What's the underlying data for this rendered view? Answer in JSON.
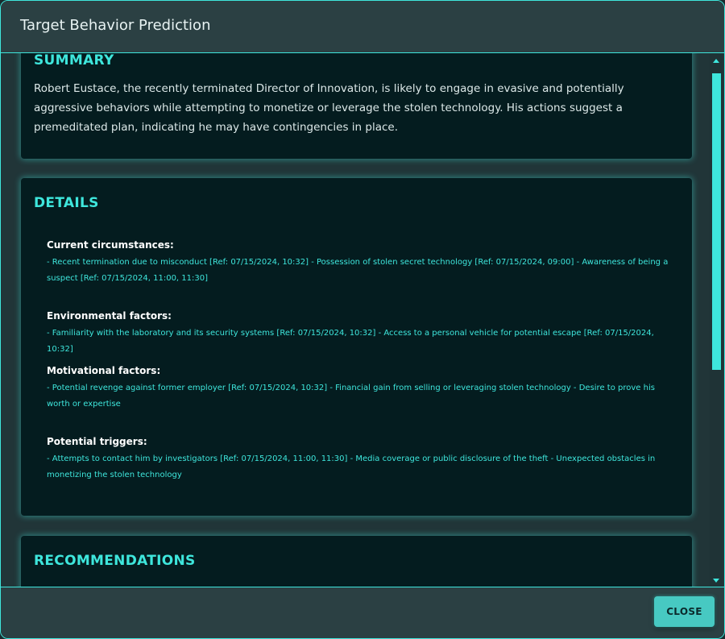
{
  "dialog": {
    "title": "Target Behavior Prediction",
    "close_label": "CLOSE"
  },
  "summary": {
    "heading": "SUMMARY",
    "text": "Robert Eustace, the recently terminated Director of Innovation, is likely to engage in evasive and potentially aggressive behaviors while attempting to monetize or leverage the stolen technology. His actions suggest a premeditated plan, indicating he may have contingencies in place."
  },
  "details": {
    "heading": "DETAILS",
    "factors": [
      {
        "title": "Current circumstances:",
        "text": "- Recent termination due to misconduct [Ref: 07/15/2024, 10:32] - Possession of stolen secret technology [Ref: 07/15/2024, 09:00] - Awareness of being a suspect [Ref: 07/15/2024, 11:00, 11:30]"
      },
      {
        "title": "Environmental factors:",
        "text": "- Familiarity with the laboratory and its security systems [Ref: 07/15/2024, 10:32] - Access to a personal vehicle for potential escape [Ref: 07/15/2024, 10:32]"
      },
      {
        "title": "Motivational factors:",
        "text": "- Potential revenge against former employer [Ref: 07/15/2024, 10:32] - Financial gain from selling or leveraging stolen technology - Desire to prove his worth or expertise"
      },
      {
        "title": "Potential triggers:",
        "text": "- Attempts to contact him by investigators [Ref: 07/15/2024, 11:00, 11:30] - Media coverage or public disclosure of the theft - Unexpected obstacles in monetizing the stolen technology"
      }
    ]
  },
  "recommendations": {
    "heading": "RECOMMENDATIONS"
  },
  "scrollbar": {
    "up_icon": "chevron-up-icon",
    "down_icon": "chevron-down-icon"
  }
}
